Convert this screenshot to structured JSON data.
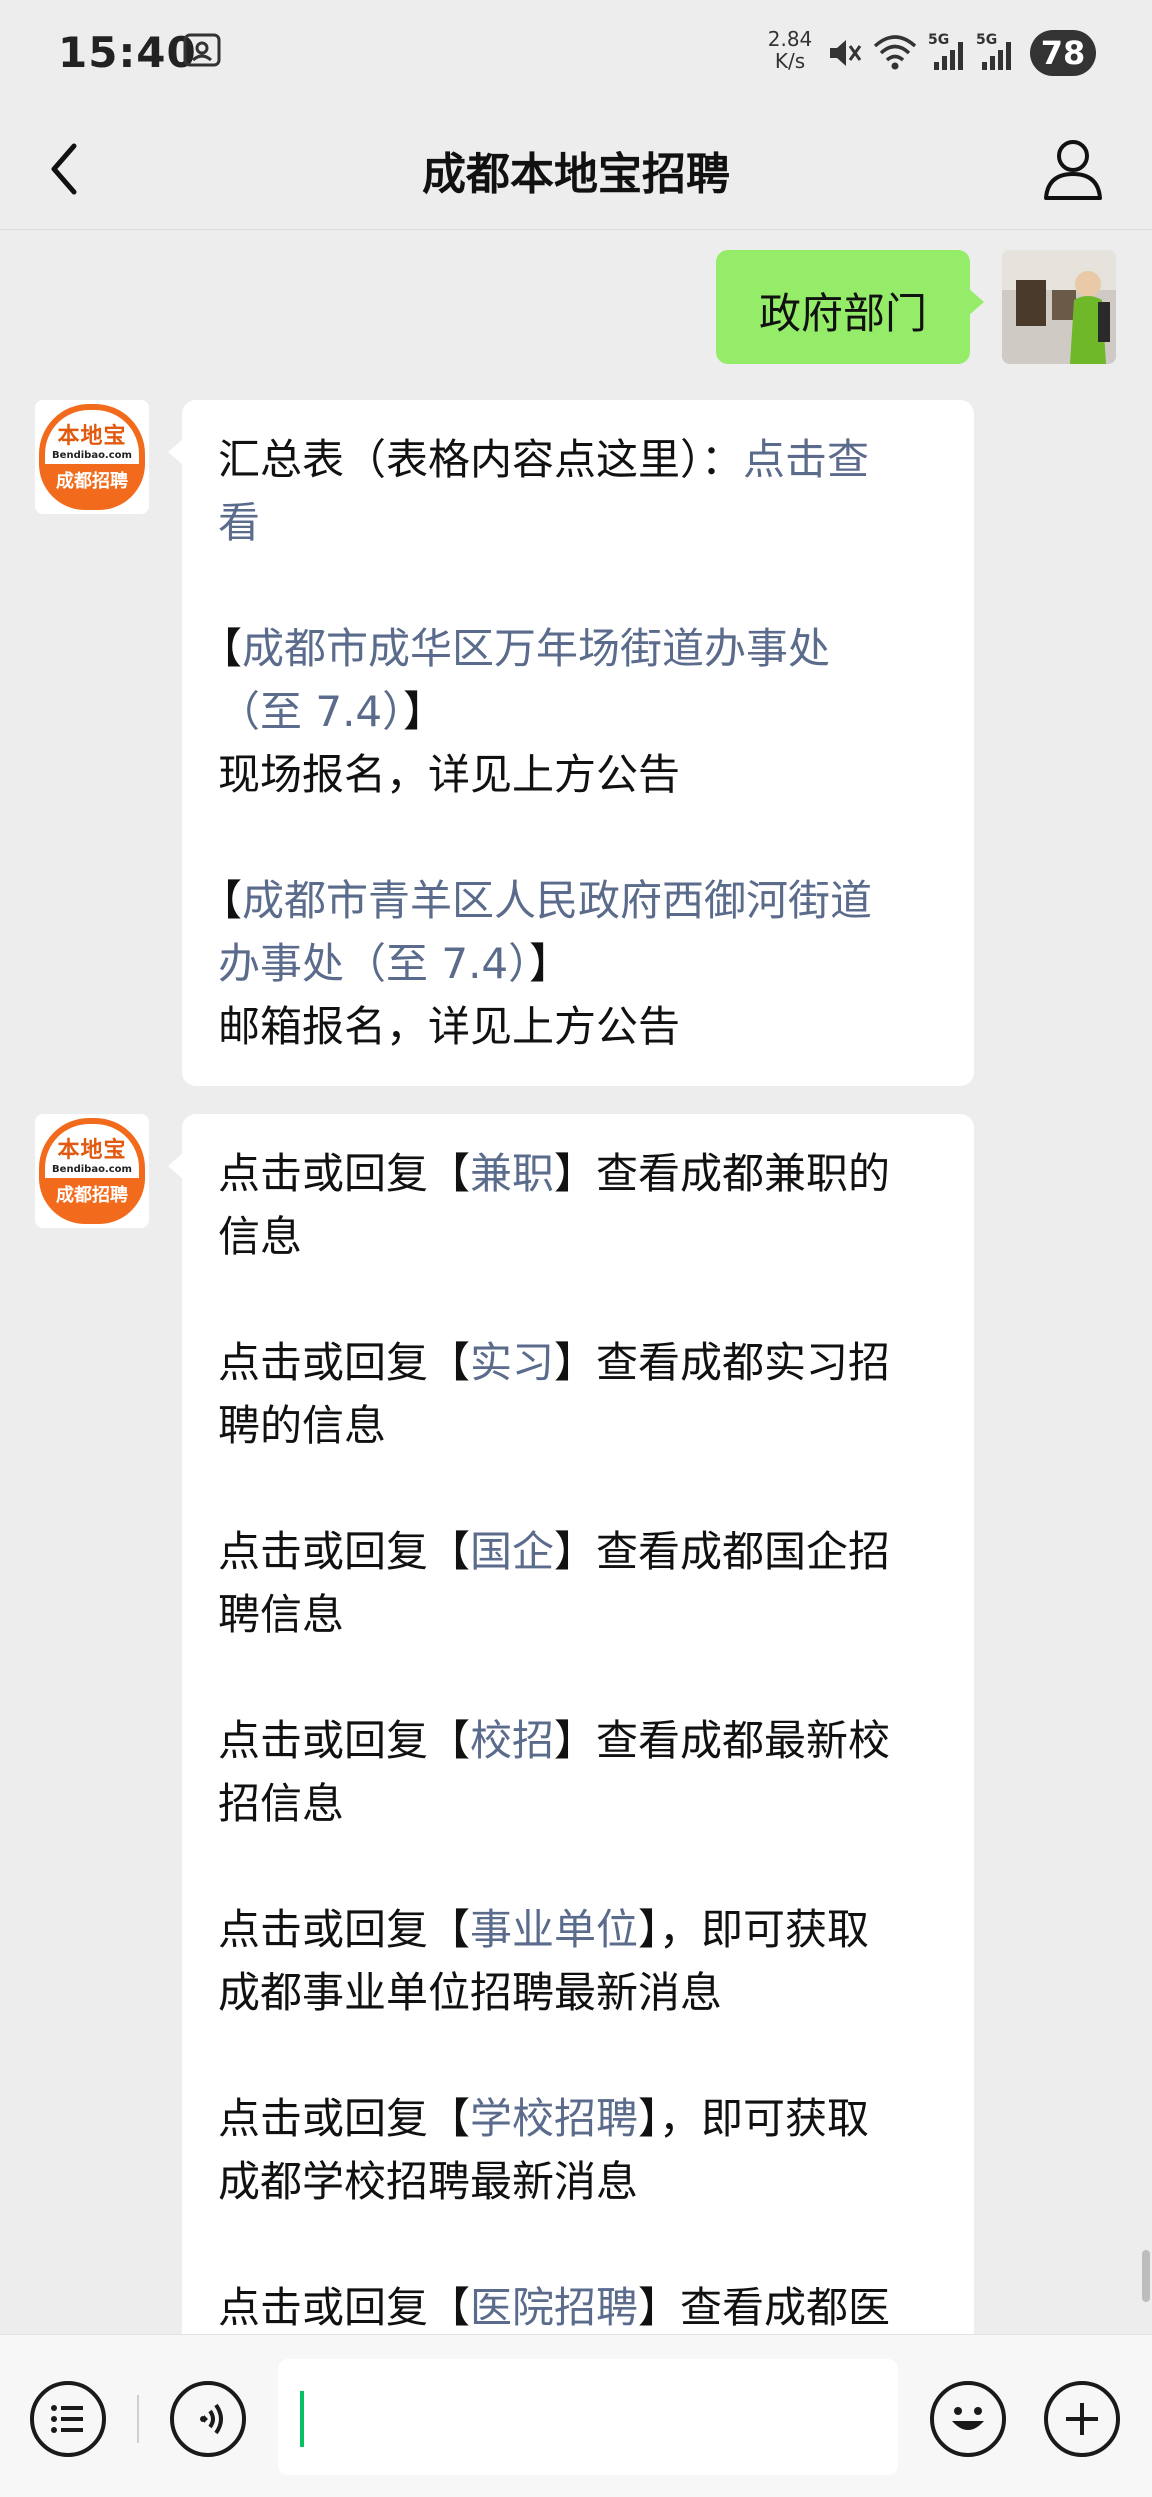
{
  "status_bar": {
    "time": "15:40",
    "net_speed_value": "2.84",
    "net_speed_unit": "K/s",
    "battery": "78",
    "icons": [
      "screen-record-icon",
      "mute-icon",
      "wifi-icon",
      "signal-5g-icon",
      "signal-5g-icon",
      "battery-icon"
    ]
  },
  "nav": {
    "title": "成都本地宝招聘"
  },
  "sent_message": {
    "text": "政府部门"
  },
  "official_avatar": {
    "brand": "本地宝",
    "url": "Bendibao.com",
    "tag": "成都招聘"
  },
  "message1": {
    "summary_prefix": "汇总表（表格内容点这里）：",
    "summary_link_a": "点击查",
    "summary_link_b": "看",
    "item1_open": "【",
    "item1_link_a": "成都市成华区万年场街道办事处",
    "item1_link_b": "（至 7.4）",
    "item1_close": "】",
    "item1_desc": "现场报名，详见上方公告",
    "item2_open": "【",
    "item2_link_a": "成都市青羊区人民政府西御河街道",
    "item2_link_b": "办事处（至 7.4）",
    "item2_close": "】",
    "item2_desc": "邮箱报名，详见上方公告"
  },
  "message2": {
    "lines": [
      {
        "pre": "点击或回复【",
        "kw": "兼职",
        "post": "】查看成都兼职的",
        "cont": "信息"
      },
      {
        "pre": "点击或回复【",
        "kw": "实习",
        "post": "】查看成都实习招",
        "cont": "聘的信息"
      },
      {
        "pre": "点击或回复【",
        "kw": "国企",
        "post": "】查看成都国企招",
        "cont": "聘信息"
      },
      {
        "pre": "点击或回复【",
        "kw": "校招",
        "post": "】查看成都最新校",
        "cont": "招信息"
      },
      {
        "pre": "点击或回复【",
        "kw": "事业单位",
        "post": "】，即可获取",
        "cont": "成都事业单位招聘最新消息"
      },
      {
        "pre": "点击或回复【",
        "kw": "学校招聘",
        "post": "】，即可获取",
        "cont": "成都学校招聘最新消息"
      },
      {
        "pre": "点击或回复【",
        "kw": "医院招聘",
        "post": "】查看成都医",
        "cont": ""
      }
    ]
  },
  "input_bar": {
    "value": ""
  }
}
